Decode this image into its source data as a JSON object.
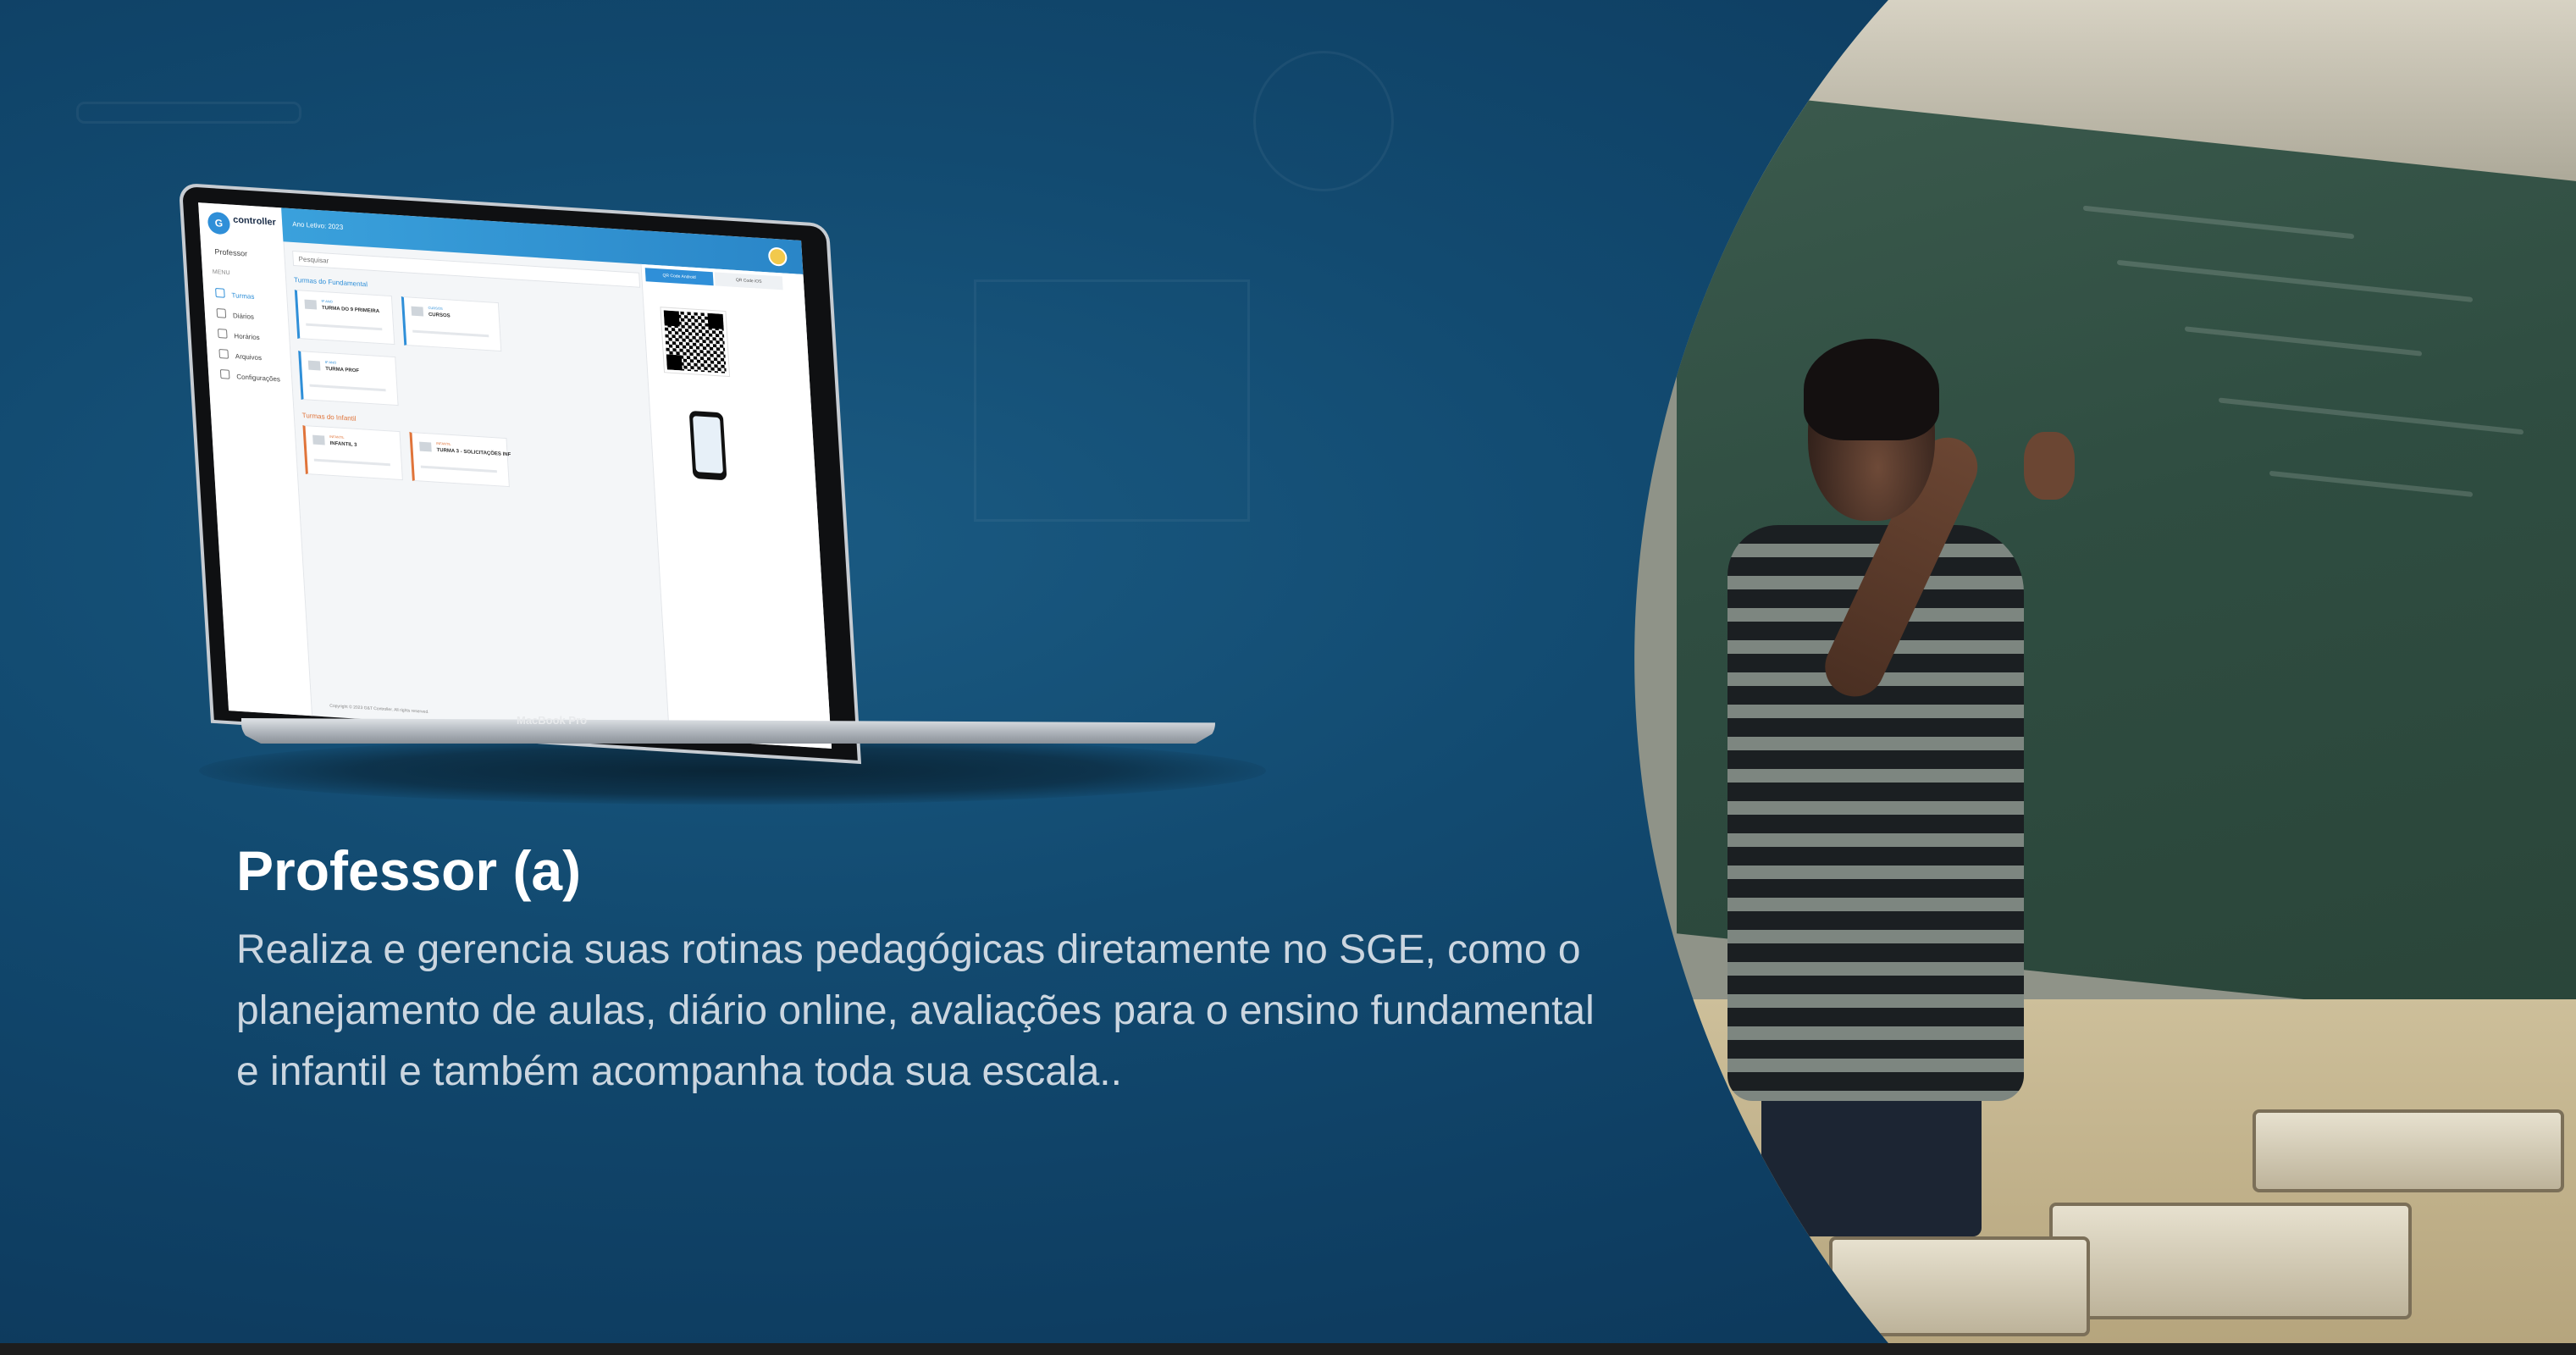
{
  "hero": {
    "title": "Professor (a)",
    "description": "Realiza e gerencia suas rotinas pedagógicas diretamente no SGE, como o planejamento de aulas, diário online, avaliações para o ensino fundamental e infantil e também acompanha toda sua escala.."
  },
  "laptop": {
    "brand": "MacBook Pro",
    "screen": {
      "logo_text": "controller",
      "role": "Professor",
      "menu_label": "MENU",
      "menu_items": [
        "Turmas",
        "Diários",
        "Horários",
        "Arquivos",
        "Configurações"
      ],
      "year_selector": "Ano Letivo: 2023",
      "search_placeholder": "Pesquisar",
      "section_fundamental": "Turmas do Fundamental",
      "section_infantil": "Turmas do Infantil",
      "cards_fundamental": [
        {
          "year": "9º ANO",
          "name": "TURMA DO 9 PRIMEIRA"
        },
        {
          "year": "CURSOS",
          "name": "CURSOS"
        },
        {
          "year": "8º ANO",
          "name": "TURMA PROF"
        }
      ],
      "cards_infantil": [
        {
          "year": "INFANTIL",
          "name": "INFANTIL 3"
        },
        {
          "year": "INFANTIL",
          "name": "TURMA 3 - SOLICITAÇÕES INF"
        }
      ],
      "panel_tabs": [
        "QR Code Android",
        "QR Code iOS"
      ],
      "copyright": "Copyright © 2023 G&T Controller. All rights reserved."
    }
  },
  "colors": {
    "background": "#124a70",
    "heading": "#ffffff",
    "body_text": "#cbd6e0",
    "accent_blue": "#2f8fd8",
    "accent_orange": "#e0743a"
  },
  "photo": {
    "icon": "teacher-at-chalkboard-photo"
  }
}
